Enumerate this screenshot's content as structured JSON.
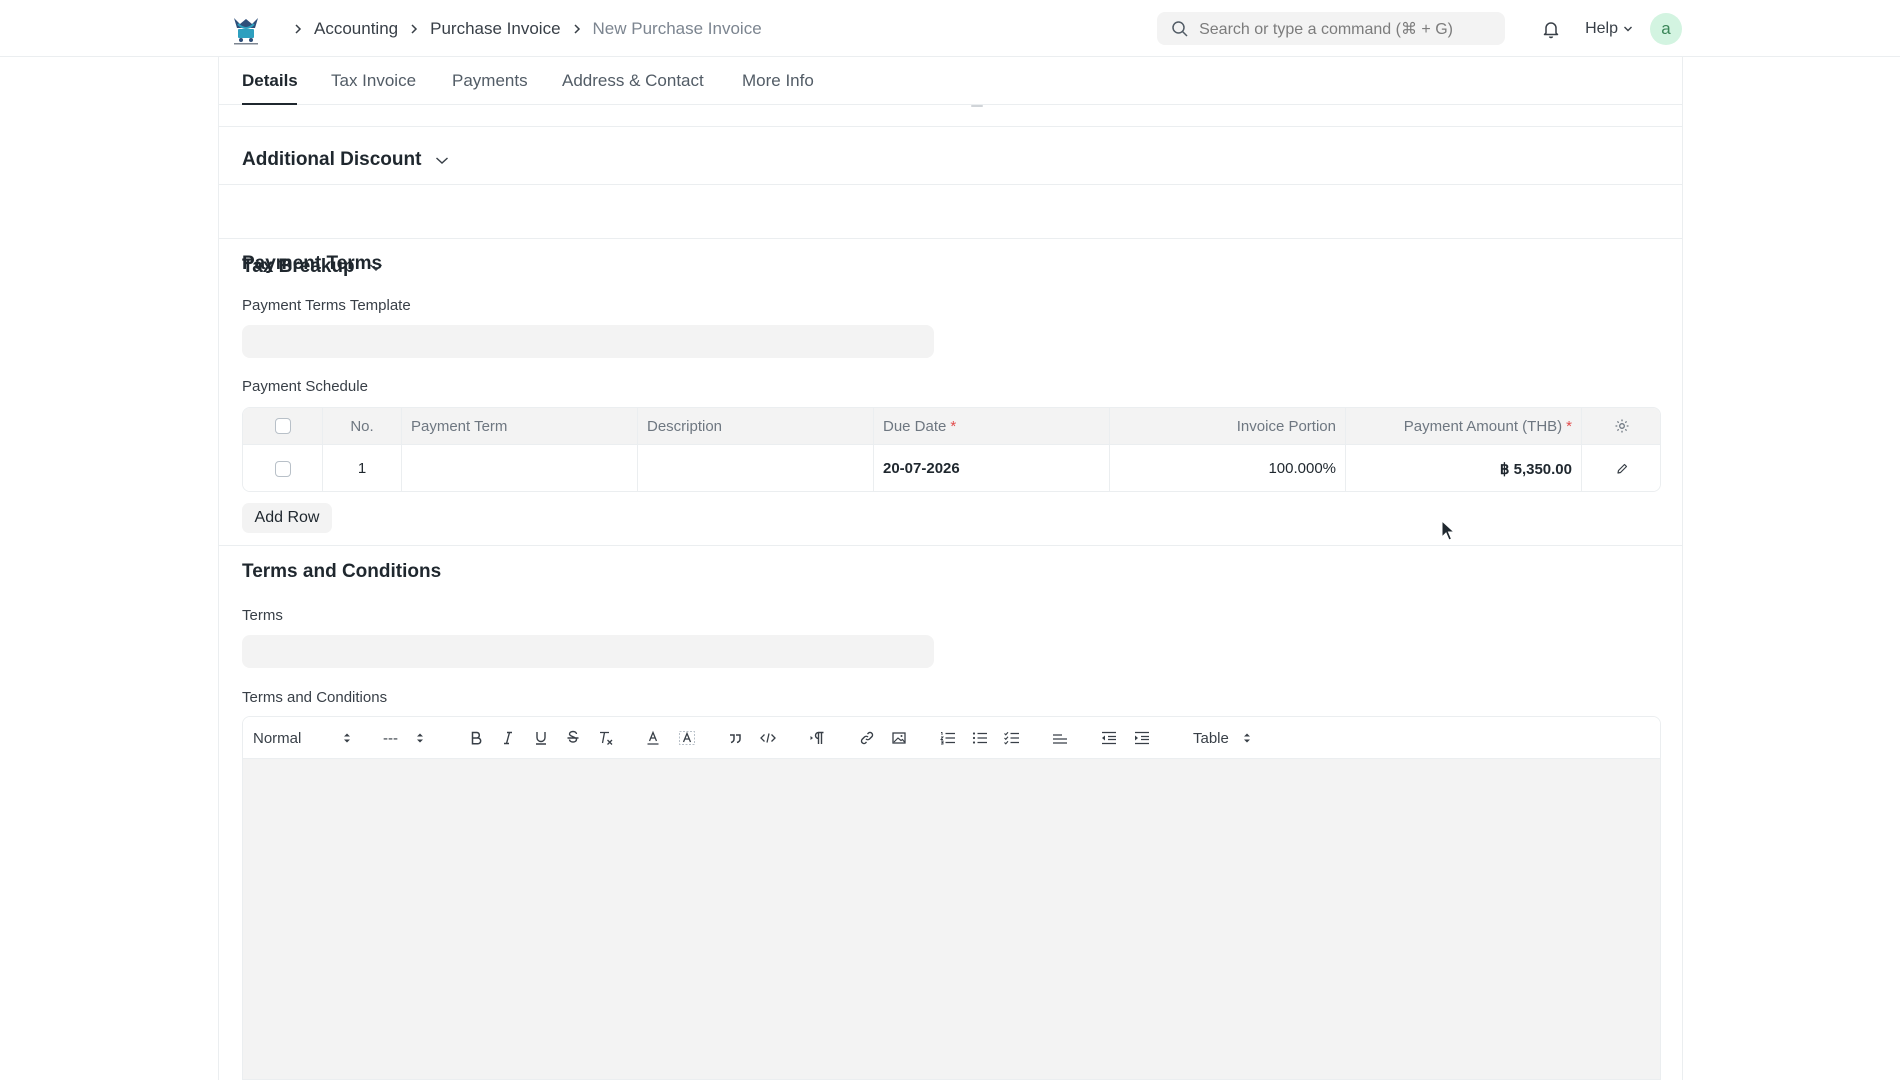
{
  "breadcrumbs": [
    "Accounting",
    "Purchase Invoice",
    "New Purchase Invoice"
  ],
  "search": {
    "placeholder": "Search or type a command (⌘ + G)"
  },
  "help_label": "Help",
  "avatar_initial": "a",
  "tabs": [
    "Details",
    "Tax Invoice",
    "Payments",
    "Address & Contact",
    "More Info"
  ],
  "sections": {
    "additional_discount": "Additional Discount",
    "tax_breakup": "Tax Breakup",
    "payment_terms": "Payment Terms",
    "terms_and_conditions": "Terms and Conditions"
  },
  "payment_terms": {
    "template_label": "Payment Terms Template",
    "template_value": "",
    "schedule_label": "Payment Schedule",
    "columns": {
      "no": "No.",
      "payment_term": "Payment Term",
      "description": "Description",
      "due_date": "Due Date",
      "invoice_portion": "Invoice Portion",
      "payment_amount": "Payment Amount (THB)",
      "required_mark": "*"
    },
    "rows": [
      {
        "no": "1",
        "payment_term": "",
        "description": "",
        "due_date": "20-07-2026",
        "invoice_portion": "100.000%",
        "payment_amount": "฿ 5,350.00"
      }
    ],
    "add_row_label": "Add Row"
  },
  "terms": {
    "terms_label": "Terms",
    "terms_value": "",
    "editor_label": "Terms and Conditions",
    "toolbar": {
      "paragraph_style": "Normal",
      "font_size": "---",
      "table_label": "Table"
    }
  },
  "colors": {
    "accent_required": "#e24c4c",
    "input_bg": "#f3f3f3",
    "avatar_bg": "#d3f4e1",
    "avatar_text": "#3a8658"
  },
  "icons": [
    "app-logo-icon",
    "chevron-right-icon",
    "search-icon",
    "bell-icon",
    "chevron-down-icon",
    "settings-gear-icon",
    "edit-pencil-icon",
    "mouse-cursor-icon"
  ]
}
